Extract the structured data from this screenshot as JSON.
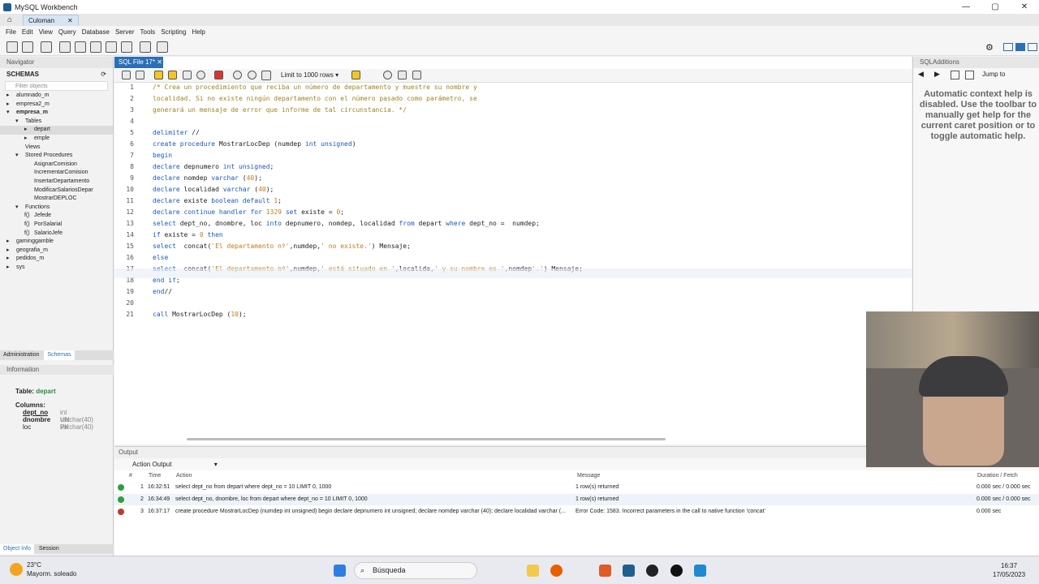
{
  "window": {
    "title": "MySQL Workbench",
    "conn_tab": "Culoman",
    "controls": [
      "—",
      "▢",
      "✕"
    ]
  },
  "menu": [
    "File",
    "Edit",
    "View",
    "Query",
    "Database",
    "Server",
    "Tools",
    "Scripting",
    "Help"
  ],
  "navigator": {
    "header": "Navigator",
    "schemas_label": "SCHEMAS",
    "filter_placeholder": "Filter objects",
    "tree": [
      {
        "label": "alumnado_m",
        "level": 0,
        "prefix": "▸"
      },
      {
        "label": "empresa2_m",
        "level": 0,
        "prefix": "▸"
      },
      {
        "label": "empresa_m",
        "level": 0,
        "prefix": "▾",
        "bold": true
      },
      {
        "label": "Tables",
        "level": 1,
        "prefix": "▾"
      },
      {
        "label": "depart",
        "level": 2,
        "prefix": "▸",
        "sel": true
      },
      {
        "label": "emple",
        "level": 2,
        "prefix": "▸"
      },
      {
        "label": "Views",
        "level": 1,
        "prefix": ""
      },
      {
        "label": "Stored Procedures",
        "level": 1,
        "prefix": "▾"
      },
      {
        "label": "AsignarComision",
        "level": 2,
        "prefix": ""
      },
      {
        "label": "IncrementarComision",
        "level": 2,
        "prefix": ""
      },
      {
        "label": "InsertarDepartamento",
        "level": 2,
        "prefix": ""
      },
      {
        "label": "ModificarSalariosDepar",
        "level": 2,
        "prefix": ""
      },
      {
        "label": "MostrarDEPLOC",
        "level": 2,
        "prefix": ""
      },
      {
        "label": "Functions",
        "level": 1,
        "prefix": "▾"
      },
      {
        "label": "Jefede",
        "level": 2,
        "prefix": "f()"
      },
      {
        "label": "PorSalarial",
        "level": 2,
        "prefix": "f()"
      },
      {
        "label": "SalarioJefe",
        "level": 2,
        "prefix": "f()"
      },
      {
        "label": "gaminggamble",
        "level": 0,
        "prefix": "▸"
      },
      {
        "label": "geografia_m",
        "level": 0,
        "prefix": "▸"
      },
      {
        "label": "pedidos_m",
        "level": 0,
        "prefix": "▸"
      },
      {
        "label": "sys",
        "level": 0,
        "prefix": "▸"
      }
    ],
    "tabs": [
      "Administration",
      "Schemas"
    ],
    "info_header": "Information",
    "info": {
      "table_label": "Table:",
      "table_name": "depart",
      "columns_label": "Columns:",
      "columns": [
        {
          "name": "dept_no",
          "type": "int UN PK"
        },
        {
          "name": "dnombre",
          "type": "varchar(40)"
        },
        {
          "name": "loc",
          "type": "varchar(40)"
        }
      ]
    },
    "bottom_tabs": [
      "Object Info",
      "Session"
    ]
  },
  "editor": {
    "tab": "SQL File 17*",
    "limit": "Limit to 1000 rows",
    "lines": [
      {
        "n": "1",
        "t": "/* Crea un procedimiento que reciba un número de departamento y muestre su nombre y",
        "c": "cm"
      },
      {
        "n": "2",
        "t": "localidad. Si no existe ningún departamento con el número pasado como parámetro, se",
        "c": "cm"
      },
      {
        "n": "3",
        "t": "generará un mensaje de error que informe de tal circunstancia. */",
        "c": "cm"
      },
      {
        "n": "4",
        "t": ""
      },
      {
        "n": "5",
        "t": "delimiter //"
      },
      {
        "n": "6",
        "t": "create procedure MostrarLocDep (numdep int unsigned)"
      },
      {
        "n": "7",
        "t": "begin"
      },
      {
        "n": "8",
        "t": "declare depnumero int unsigned;"
      },
      {
        "n": "9",
        "t": "declare nomdep varchar (40);"
      },
      {
        "n": "10",
        "t": "declare localidad varchar (40);"
      },
      {
        "n": "11",
        "t": "declare existe boolean default 1;"
      },
      {
        "n": "12",
        "t": "declare continue handler for 1329 set existe = 0;"
      },
      {
        "n": "13",
        "t": "select dept_no, dnombre, loc into depnumero, nomdep, localidad from depart where dept_no =  numdep;"
      },
      {
        "n": "14",
        "t": "if existe = 0 then"
      },
      {
        "n": "15",
        "t": "select  concat('El departamento nº',numdep,' no existe.') Mensaje;"
      },
      {
        "n": "16",
        "t": "else"
      },
      {
        "n": "17",
        "t": "select  concat('El departamento nº',numdep,' está situado en ',localida,' y su nombre es ',nomdep'.') Mensaje;"
      },
      {
        "n": "18",
        "t": "end if;"
      },
      {
        "n": "19",
        "t": "end//"
      },
      {
        "n": "20",
        "t": ""
      },
      {
        "n": "21",
        "t": "call MostrarLocDep (10);"
      }
    ]
  },
  "sqladditions": {
    "header": "SQLAdditions",
    "jump_to": "Jump to",
    "help_text": "Automatic context help is disabled. Use the toolbar to manually get help for the current caret position or to toggle automatic help."
  },
  "output": {
    "header": "Output",
    "selector": "Action Output",
    "columns": [
      "#",
      "Time",
      "Action",
      "Message",
      "Duration / Fetch"
    ],
    "rows": [
      {
        "n": "1",
        "time": "16:32:51",
        "action": "select dept_no from depart where dept_no =  10 LIMIT 0, 1000",
        "message": "1 row(s) returned",
        "duration": "0.000 sec / 0.000 sec",
        "status": "ok"
      },
      {
        "n": "2",
        "time": "16:34:49",
        "action": "select dept_no, dnombre, loc from depart where dept_no =  10 LIMIT 0, 1000",
        "message": "1 row(s) returned",
        "duration": "0.000 sec / 0.000 sec",
        "status": "ok"
      },
      {
        "n": "3",
        "time": "16:37:17",
        "action": "create procedure MostrarLocDep (numdep int unsigned) begin declare depnumero int unsigned; declare nomdep varchar (40); declare localidad varchar (...",
        "message": "Error Code: 1583. Incorrect parameters in the call to native function 'concat'",
        "duration": "0.000 sec",
        "status": "error"
      }
    ]
  },
  "taskbar": {
    "weather_temp": "23°C",
    "weather_desc": "Mayorm. soleado",
    "search": "Búsqueda",
    "time": "16:37",
    "date": "17/05/2023"
  },
  "colors": {
    "accent": "#2b6fb7",
    "ok": "#2e9e3e",
    "error": "#c0392b"
  }
}
